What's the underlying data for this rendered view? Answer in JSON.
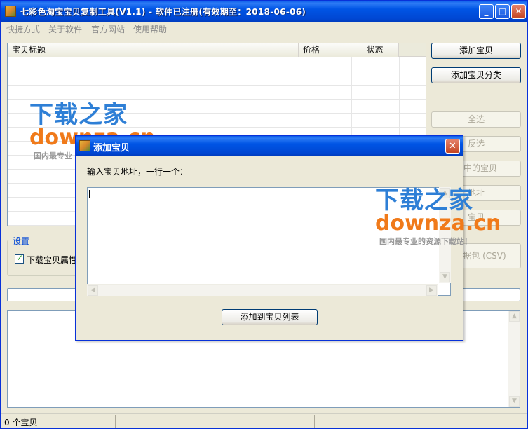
{
  "window": {
    "title": "七彩色淘宝宝贝复制工具(V1.1) - 软件已注册(有效期至：2018-06-06)",
    "title_buttons": {
      "minimize": "_",
      "maximize": "□",
      "close": "✕"
    }
  },
  "menu": [
    "快捷方式",
    "关于软件",
    "官方网站",
    "使用帮助"
  ],
  "list": {
    "columns": [
      "宝贝标题",
      "价格",
      "状态"
    ],
    "rows": []
  },
  "right_buttons": [
    {
      "label": "添加宝贝",
      "enabled": true
    },
    {
      "label": "添加宝贝分类",
      "enabled": true
    },
    {
      "label": "全选",
      "enabled": false
    },
    {
      "label": "反选",
      "enabled": false
    },
    {
      "label": "选中的宝贝",
      "enabled": false
    },
    {
      "label": "地址",
      "enabled": false
    },
    {
      "label": "宝贝",
      "enabled": false
    }
  ],
  "settings": {
    "group_label": "设置",
    "download_props": {
      "label": "下载宝贝属性",
      "checked": true
    },
    "csv_button": "宝数据包 (CSV)"
  },
  "statusbar": {
    "text": "0 个宝贝"
  },
  "dialog": {
    "title": "添加宝贝",
    "close": "✕",
    "prompt": "输入宝贝地址，一行一个：",
    "textarea_value": "",
    "add_button": "添加到宝贝列表"
  },
  "watermarks": [
    {
      "cn": "下载之家",
      "en": "downza.cn",
      "sub": "国内最专业"
    },
    {
      "cn": "下载之家",
      "en": "downza.cn",
      "sub": "国内最专业的资源下载站！"
    }
  ],
  "colors": {
    "title_bar": "#0055e5",
    "accent_blue": "#2e7fd6",
    "accent_orange": "#f07a1a",
    "face": "#ece9d8"
  }
}
